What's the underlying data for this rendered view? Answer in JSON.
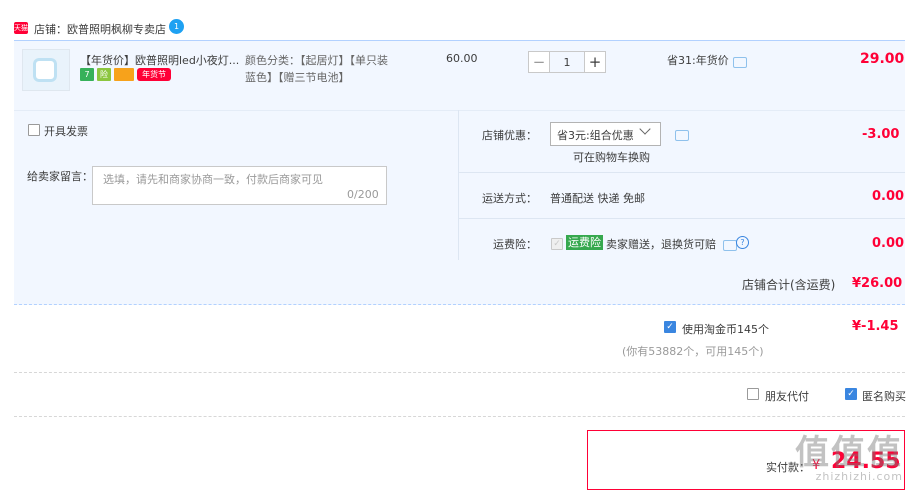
{
  "store": {
    "badge": "天猫",
    "label": "店铺：欧普照明枫柳专卖店",
    "chat_icon_text": "1"
  },
  "item": {
    "title": "【年货价】欧普照明led小夜灯...",
    "tags": [
      "7",
      "险",
      "",
      "年货节"
    ],
    "sku_line1": "颜色分类：【起居灯】【单只装",
    "sku_line2": "蓝色】【赠三节电池】",
    "unit_price": "60.00",
    "qty_minus": "−",
    "qty_value": "1",
    "qty_plus": "+",
    "saving": "省31:年货价",
    "total": "29.00"
  },
  "options": {
    "invoice_label": "开具发票",
    "message_label": "给卖家留言：",
    "message_placeholder": "选填，请先和商家协商一致，付款后商家可见",
    "message_count": "0/200",
    "shop_discount_label": "店铺优惠：",
    "shop_discount_select": "省3元:组合优惠",
    "shop_discount_note": "可在购物车换购",
    "shop_discount_value": "-3.00",
    "shipping_label": "运送方式：",
    "shipping_value": "普通配送 快递 免邮",
    "shipping_amount": "0.00",
    "insurance_label": "运费险：",
    "insurance_badge": "运费险",
    "insurance_text": "卖家赠送，退换货可赔",
    "insurance_amount": "0.00"
  },
  "subtotal": {
    "label": "店铺合计(含运费)",
    "value": "¥26.00"
  },
  "coins": {
    "label": "使用淘金币145个",
    "value": "¥-1.45",
    "note": "(你有53882个，可用145个)"
  },
  "extras": {
    "friend_pay": "朋友代付",
    "anonymous": "匿名购买"
  },
  "total": {
    "label": "实付款：",
    "currency": "¥",
    "amount": "24.55"
  },
  "watermark": {
    "logo": "值值值",
    "url": "zhizhizhi.com"
  },
  "colors": {
    "accent": "#ff0036",
    "panel": "#f2f7ff",
    "checkbox": "#3a86e0",
    "insurance": "#36a84e"
  }
}
